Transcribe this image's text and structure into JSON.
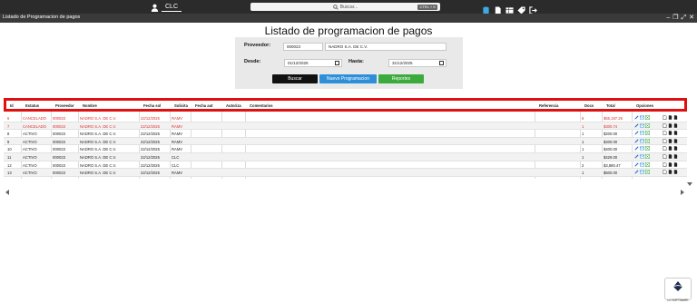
{
  "topbar": {
    "user_name": "CLC",
    "search_placeholder": "Buscar...",
    "search_shortcut": "CTRL + K"
  },
  "window": {
    "title": "Listado de Programacion de pagos"
  },
  "page": {
    "title": "Listado de programacion de pagos"
  },
  "filter": {
    "proveedor_label": "Proveedor:",
    "proveedor_code": "000023",
    "proveedor_name": "NADRO S.A. DE C.V.",
    "desde_label": "Desde:",
    "desde_value": "01/12/2025",
    "hasta_label": "Hasta:",
    "hasta_value": "31/12/2025",
    "buscar_label": "Buscar",
    "nuevo_label": "Nuevo Programacion",
    "reportes_label": "Reportes"
  },
  "table": {
    "headers": [
      "Id",
      "Estatus",
      "Proveedor",
      "Nombre",
      "Fecha sol",
      "Solicita",
      "Fecha aut",
      "Autoriza",
      "Comentarios",
      "Referencia",
      "Docs",
      "Total",
      "Opciones"
    ],
    "rows": [
      [
        "6",
        "CANCELADO",
        "000023",
        "NADRO S.A. DE C.V.",
        "22/12/2025",
        "RAMV",
        "",
        "",
        "",
        "",
        "6",
        "$55,187.25"
      ],
      [
        "7",
        "CANCELADO",
        "000023",
        "NADRO S.A. DE C.V.",
        "22/12/2025",
        "RAMV",
        "",
        "",
        "",
        "",
        "1",
        "$300.74"
      ],
      [
        "8",
        "ACTIVO",
        "000023",
        "NADRO S.A. DE C.V.",
        "22/12/2025",
        "RAMV",
        "",
        "",
        "",
        "",
        "1",
        "$200.00"
      ],
      [
        "9",
        "ACTIVO",
        "000023",
        "NADRO S.A. DE C.V.",
        "22/12/2025",
        "RAMV",
        "",
        "",
        "",
        "",
        "1",
        "$400.00"
      ],
      [
        "10",
        "ACTIVO",
        "000023",
        "NADRO S.A. DE C.V.",
        "22/12/2025",
        "RAMV",
        "",
        "",
        "",
        "",
        "1",
        "$400.00"
      ],
      [
        "11",
        "ACTIVO",
        "000023",
        "NADRO S.A. DE C.V.",
        "22/12/2025",
        "CLC",
        "",
        "",
        "",
        "",
        "1",
        "$429.00"
      ],
      [
        "12",
        "ACTIVO",
        "000023",
        "NADRO S.A. DE C.V.",
        "22/12/2025",
        "CLC",
        "",
        "",
        "",
        "",
        "2",
        "$3,880.47"
      ],
      [
        "13",
        "ACTIVO",
        "000023",
        "NADRO S.A. DE C.V.",
        "22/12/2025",
        "RAMV",
        "",
        "",
        "",
        "",
        "1",
        "$500.00"
      ]
    ]
  },
  "logo": {
    "text": "LC SOFTWARE"
  },
  "colors": {
    "highlight": "#e01010",
    "cancel": "#e03030",
    "buscar": "#111111",
    "nuevo": "#2e8fd8",
    "reportes": "#3caa3c"
  }
}
